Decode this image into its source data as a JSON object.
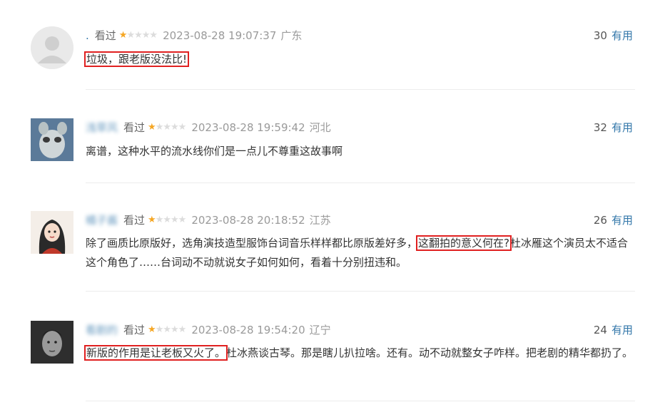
{
  "comments": [
    {
      "username": ".",
      "status": "看过",
      "rating": 1,
      "time": "2023-08-28 19:07:37",
      "location": "广东",
      "votes": "30",
      "vote_label": "有用",
      "content_hl": "垃圾，跟老版没法比!",
      "content_rest": ""
    },
    {
      "username": "浅草风",
      "status": "看过",
      "rating": 1,
      "time": "2023-08-28 19:59:42",
      "location": "河北",
      "votes": "32",
      "vote_label": "有用",
      "content": "离谱，这种水平的流水线你们是一点儿不尊重这故事啊"
    },
    {
      "username": "橘子酱",
      "status": "看过",
      "rating": 1,
      "time": "2023-08-28 20:18:52",
      "location": "江苏",
      "votes": "26",
      "vote_label": "有用",
      "content_pre": "除了画质比原版好，选角演技造型服饰台词音乐样样都比原版差好多，",
      "content_hl": "这翻拍的意义何在?",
      "content_post": "杜冰雁这个演员太不适合这个角色了……台词动不动就说女子如何如何，看着十分别扭违和。"
    },
    {
      "username": "看剧的",
      "status": "看过",
      "rating": 1,
      "time": "2023-08-28 19:54:20",
      "location": "辽宁",
      "votes": "24",
      "vote_label": "有用",
      "content_hl": "新版的作用是让老板又火了。",
      "content_post": "杜冰燕谈古琴。那是瞎儿扒拉啥。还有。动不动就整女子咋样。把老剧的精华都扔了。"
    }
  ]
}
